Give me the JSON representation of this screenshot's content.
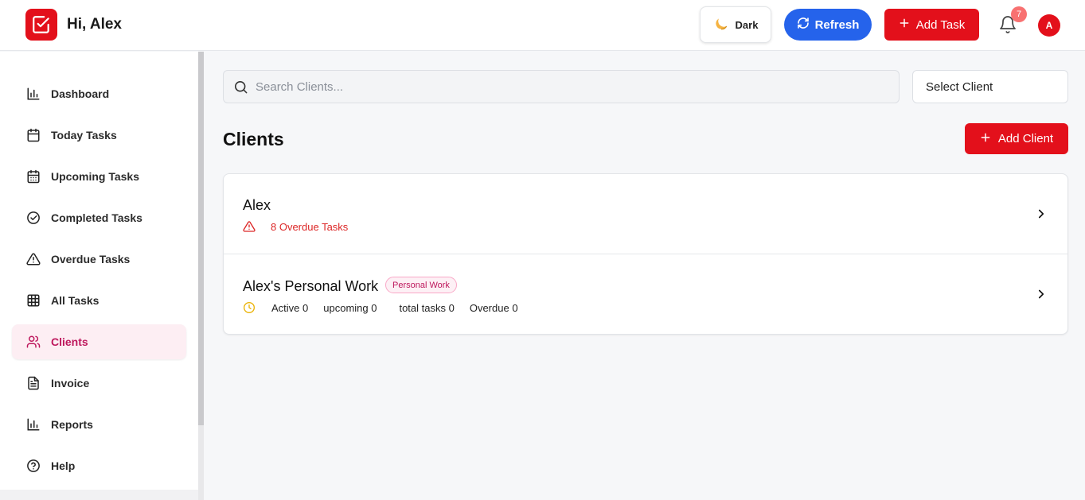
{
  "header": {
    "greeting": "Hi, Alex",
    "theme_button": "Dark",
    "refresh_button": "Refresh",
    "add_task_button": "Add Task",
    "notification_count": "7",
    "avatar_initial": "A"
  },
  "sidebar": {
    "items": [
      {
        "label": "Dashboard",
        "icon": "bar-chart-icon"
      },
      {
        "label": "Today Tasks",
        "icon": "calendar-icon"
      },
      {
        "label": "Upcoming Tasks",
        "icon": "calendar-grid-icon"
      },
      {
        "label": "Completed Tasks",
        "icon": "check-circle-icon"
      },
      {
        "label": "Overdue Tasks",
        "icon": "warning-triangle-icon"
      },
      {
        "label": "All Tasks",
        "icon": "table-grid-icon"
      },
      {
        "label": "Clients",
        "icon": "users-icon",
        "active": true
      },
      {
        "label": "Invoice",
        "icon": "document-icon"
      },
      {
        "label": "Reports",
        "icon": "bar-chart-icon"
      },
      {
        "label": "Help",
        "icon": "help-circle-icon"
      }
    ]
  },
  "main": {
    "search_placeholder": "Search Clients...",
    "select_client": "Select Client",
    "title": "Clients",
    "add_client_button": "Add Client",
    "clients": [
      {
        "name": "Alex",
        "overdue_text": "8 Overdue Tasks"
      },
      {
        "name": "Alex's Personal Work",
        "tag": "Personal Work",
        "stats": {
          "active": "Active 0",
          "upcoming": "upcoming 0",
          "total": "total tasks 0",
          "overdue": "Overdue 0"
        }
      }
    ]
  },
  "colors": {
    "brand_red": "#e3101b",
    "refresh_blue": "#2563eb",
    "active_pink": "#be185d"
  }
}
